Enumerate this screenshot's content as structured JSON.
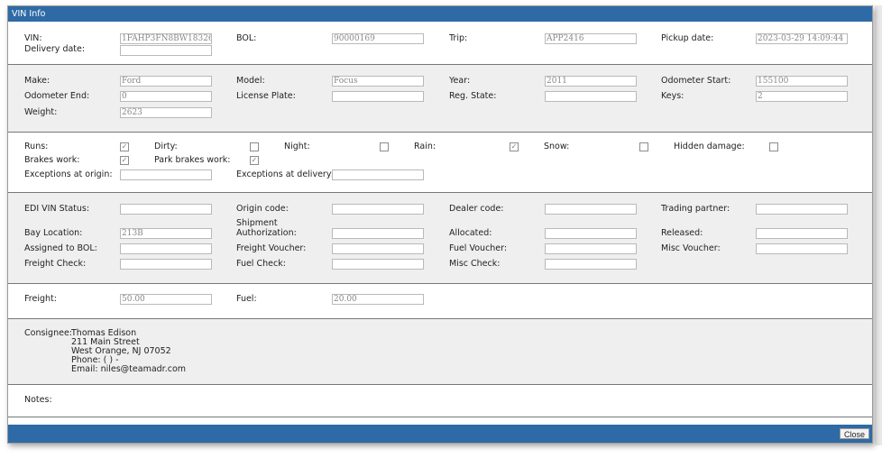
{
  "dialog": {
    "title": "VIN Info",
    "close_label": "Close"
  },
  "shipment": {
    "vin_label": "VIN:",
    "vin_value": "1FAHP3FN8BW183267",
    "bol_label": "BOL:",
    "bol_value": "90000169",
    "trip_label": "Trip:",
    "trip_value": "APP2416",
    "pickup_label": "Pickup date:",
    "pickup_value": "2023-03-29 14:09:44",
    "delivery_label": "Delivery date:",
    "delivery_value": ""
  },
  "vehicle": {
    "make_label": "Make:",
    "make_value": "Ford",
    "model_label": "Model:",
    "model_value": "Focus",
    "year_label": "Year:",
    "year_value": "2011",
    "odo_start_label": "Odometer Start:",
    "odo_start_value": "155100",
    "odo_end_label": "Odometer End:",
    "odo_end_value": "0",
    "plate_label": "License Plate:",
    "plate_value": "",
    "reg_state_label": "Reg. State:",
    "reg_state_value": "",
    "keys_label": "Keys:",
    "keys_value": "2",
    "weight_label": "Weight:",
    "weight_value": "2623"
  },
  "condition": {
    "runs_label": "Runs:",
    "runs_checked": true,
    "dirty_label": "Dirty:",
    "dirty_checked": false,
    "night_label": "Night:",
    "night_checked": false,
    "rain_label": "Rain:",
    "rain_checked": true,
    "snow_label": "Snow:",
    "snow_checked": false,
    "hidden_label": "Hidden damage:",
    "hidden_checked": false,
    "brakes_label": "Brakes work:",
    "brakes_checked": true,
    "park_brakes_label": "Park brakes work:",
    "park_brakes_checked": true,
    "exc_origin_label": "Exceptions at origin:",
    "exc_origin_value": "",
    "exc_delivery_label": "Exceptions at delivery:",
    "exc_delivery_value": "",
    "check_mark": "✓"
  },
  "edi": {
    "edi_status_label": "EDI VIN Status:",
    "edi_status_value": "",
    "origin_code_label": "Origin code:",
    "origin_code_value": "",
    "dealer_code_label": "Dealer code:",
    "dealer_code_value": "",
    "trading_partner_label": "Trading partner:",
    "trading_partner_value": "",
    "bay_label": "Bay Location:",
    "bay_value": "213B",
    "ship_auth_label_1": "Shipment",
    "ship_auth_label_2": "Authorization:",
    "ship_auth_value": "",
    "allocated_label": "Allocated:",
    "allocated_value": "",
    "released_label": "Released:",
    "released_value": "",
    "assigned_bol_label": "Assigned to BOL:",
    "assigned_bol_value": "",
    "freight_voucher_label": "Freight Voucher:",
    "freight_voucher_value": "",
    "fuel_voucher_label": "Fuel Voucher:",
    "fuel_voucher_value": "",
    "misc_voucher_label": "Misc Voucher:",
    "misc_voucher_value": "",
    "freight_check_label": "Freight Check:",
    "freight_check_value": "",
    "fuel_check_label": "Fuel Check:",
    "fuel_check_value": "",
    "misc_check_label": "Misc Check:",
    "misc_check_value": ""
  },
  "charges": {
    "freight_label": "Freight:",
    "freight_value": "50.00",
    "fuel_label": "Fuel:",
    "fuel_value": "20.00"
  },
  "consignee": {
    "label": "Consignee:",
    "name": "Thomas Edison",
    "street": "211 Main Street",
    "city": "West Orange, NJ 07052",
    "phone": "Phone: ( ) -",
    "email": "Email: niles@teamadr.com"
  },
  "notes": {
    "label": "Notes:"
  }
}
